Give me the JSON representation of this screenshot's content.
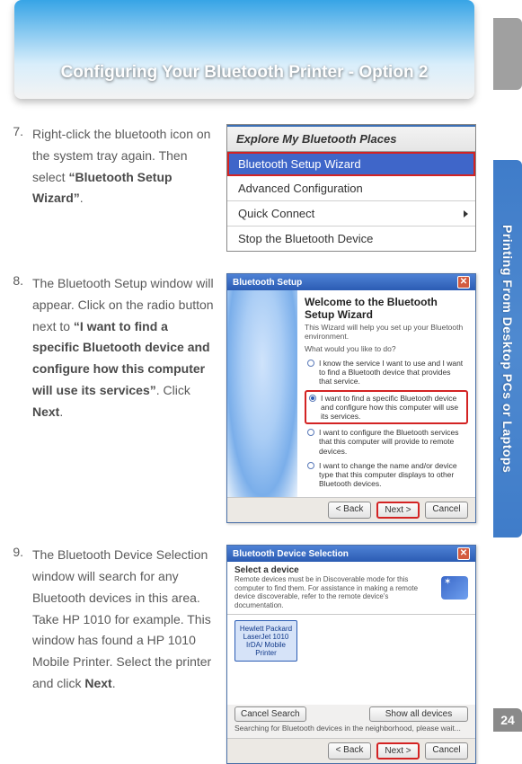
{
  "page_number": "24",
  "side_tab_label": "Printing From Desktop PCs or Laptops",
  "banner_title": "Configuring Your Bluetooth Printer - Option 2",
  "steps": {
    "s7": {
      "num": "7.",
      "text_a": "Right-click the bluetooth icon on the system tray again. Then select ",
      "bold_a": "“Bluetooth Setup Wizard”",
      "text_b": "."
    },
    "s8": {
      "num": "8.",
      "text_a": "The Bluetooth Setup window will appear. Click on the radio button next to ",
      "bold_a": "“I want to find a specific Bluetooth device and configure how this computer will use its services”",
      "text_b": ".  Click ",
      "bold_b": "Next",
      "text_c": "."
    },
    "s9": {
      "num": "9.",
      "text_a": "The Bluetooth Device Selection window will search for any Bluetooth devices in this area. Take HP 1010 for example. This window has found a HP 1010 Mobile Printer. Select the printer and click ",
      "bold_a": "Next",
      "text_b": "."
    }
  },
  "fig1": {
    "title": "Explore My Bluetooth Places",
    "items": [
      {
        "label": "Bluetooth Setup Wizard",
        "selected": true,
        "framed": true
      },
      {
        "label": "Advanced Configuration"
      },
      {
        "label": "Quick Connect",
        "submenu": true
      },
      {
        "label": "Stop the Bluetooth Device"
      }
    ]
  },
  "fig2": {
    "titlebar": "Bluetooth Setup",
    "heading": "Welcome to the Bluetooth Setup Wizard",
    "sub": "This Wizard will help you set up your Bluetooth environment.",
    "prompt": "What would you like to do?",
    "opts": {
      "a": "I know the service I want to use and I want to find a Bluetooth device that provides that service.",
      "b": "I want to find a specific Bluetooth device and configure how this computer will use its services.",
      "c": "I want to configure the Bluetooth services that this computer will provide to remote devices.",
      "d": "I want to change the name and/or device type that this computer displays to other Bluetooth devices."
    },
    "buttons": {
      "back": "< Back",
      "next": "Next >",
      "cancel": "Cancel"
    }
  },
  "fig3": {
    "titlebar": "Bluetooth Device Selection",
    "heading": "Select a device",
    "sub": "Remote devices must be in Discoverable mode for this computer to find them. For assistance in making a remote device discoverable, refer to the remote device's documentation.",
    "device": "Hewlett Packard LaserJet 1010 IrDA/ Mobile Printer",
    "btn_cancel_search": "Cancel Search",
    "dropdown": "Show all devices",
    "status": "Searching for Bluetooth devices in the neighborhood, please wait...",
    "buttons": {
      "back": "< Back",
      "next": "Next >",
      "cancel": "Cancel"
    }
  }
}
